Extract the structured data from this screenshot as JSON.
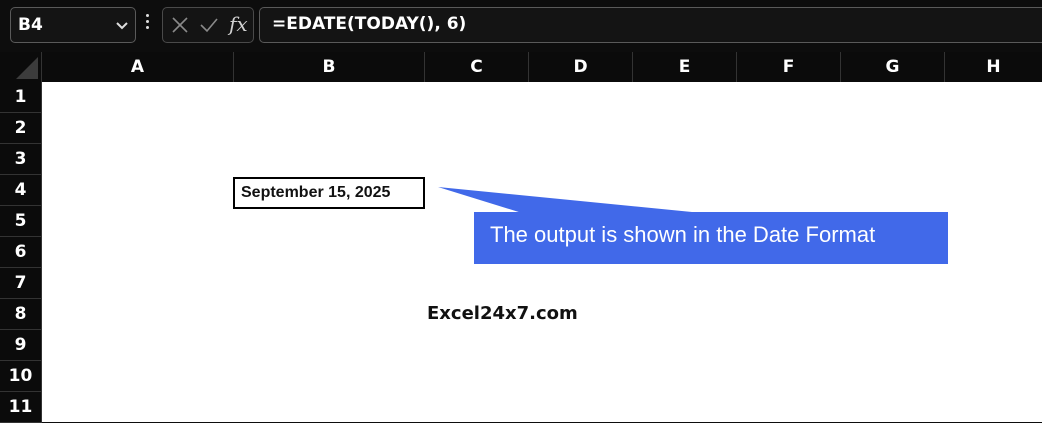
{
  "name_box": {
    "value": "B4"
  },
  "formula_bar": {
    "cancel_icon": "close-icon",
    "enter_icon": "check-icon",
    "fx_label": "fx",
    "formula": "=EDATE(TODAY(), 6)"
  },
  "columns": [
    "A",
    "B",
    "C",
    "D",
    "E",
    "F",
    "G",
    "H"
  ],
  "rows": [
    "1",
    "2",
    "3",
    "4",
    "5",
    "6",
    "7",
    "8",
    "9",
    "10",
    "11"
  ],
  "cells": {
    "B4": "September 15, 2025"
  },
  "callout": {
    "text": "The output is shown in the Date Format",
    "color": "#4169e9"
  },
  "watermark": "Excel24x7.com"
}
